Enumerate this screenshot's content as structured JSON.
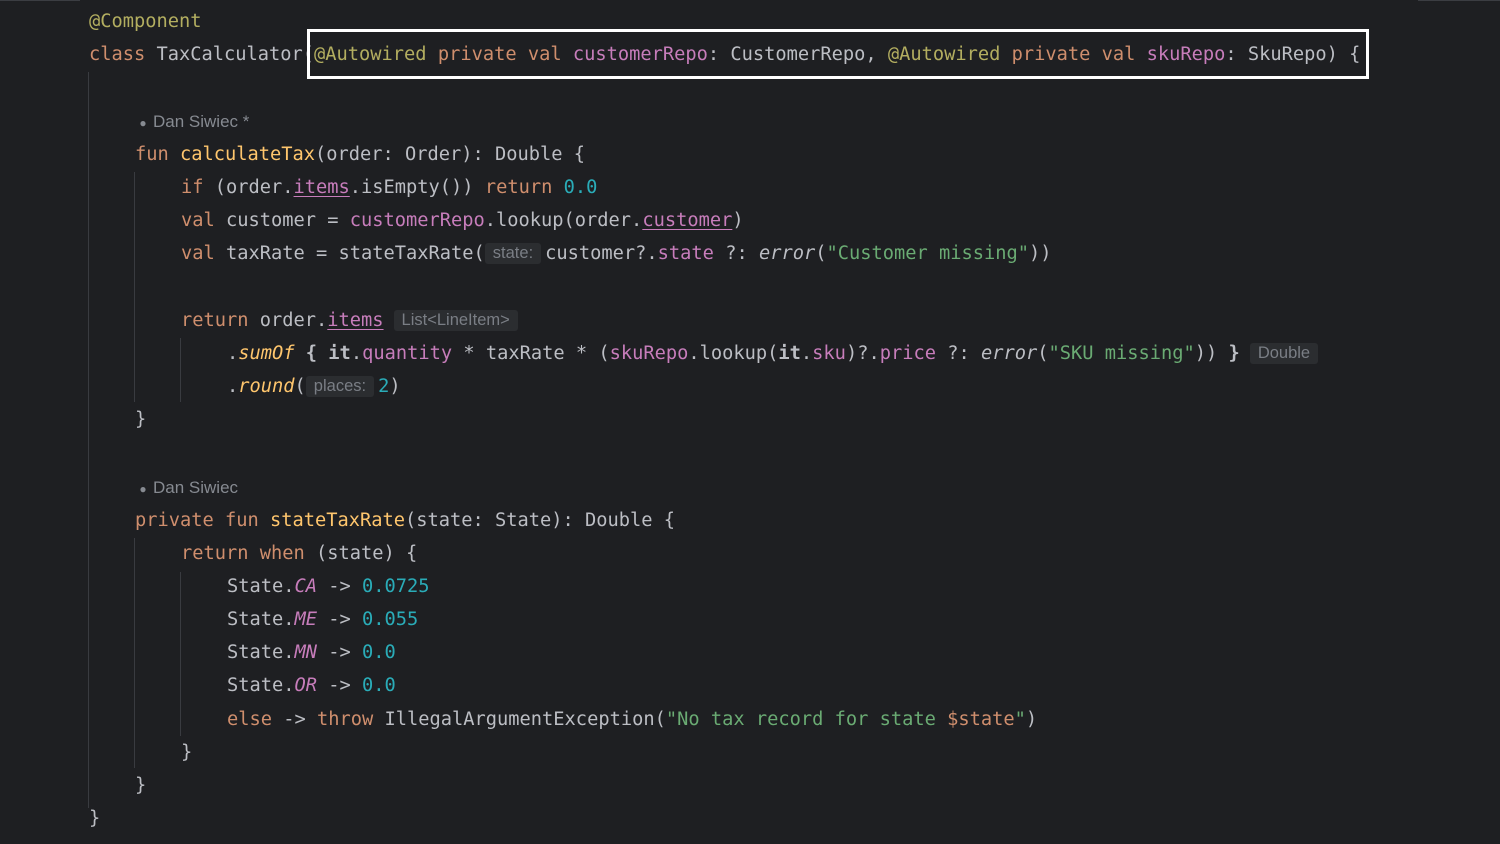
{
  "editor": {
    "annotation_line": "@Component",
    "class_line": {
      "kw_class": "class",
      "class_name": " TaxCalculator",
      "open_paren": "(",
      "autowired1": "@Autowired",
      "private1": " private val ",
      "param1_name": "customerRepo",
      "param1_type": ": CustomerRepo, ",
      "autowired2": "@Autowired",
      "private2": " private val ",
      "param2_name": "skuRepo",
      "param2_type": ": SkuRepo",
      "close": ") {"
    },
    "author1": "Dan Siwiec *",
    "author2": "Dan Siwiec",
    "calc_sig": {
      "kw": "fun ",
      "name": "calculateTax",
      "rest": "(order: Order): Double {"
    },
    "if_line": {
      "kw_if": "if",
      "pre": " (order.",
      "items": "items",
      "post": ".isEmpty()) ",
      "kw_return": "return",
      "num": " 0.0"
    },
    "customer_line": {
      "kw_val": "val",
      "pre": " customer = ",
      "repo": "customerRepo",
      "mid": ".lookup(order.",
      "cust": "customer",
      "post": ")"
    },
    "taxrate_line": {
      "kw_val": "val",
      "pre": " taxRate = stateTaxRate(",
      "hint": "state:",
      "cust": "customer?.",
      "state": "state",
      "elvis": " ?: ",
      "error": "error",
      "open": "(",
      "msg": "\"Customer missing\"",
      "close": "))"
    },
    "return_items": {
      "kw": "return",
      "pre": " order.",
      "items": "items",
      "hint": "List<LineItem>"
    },
    "sumof_line": {
      "dot": ".",
      "sumof": "sumOf",
      "brace": " { ",
      "it1": "it",
      "dot2": ".",
      "qty": "quantity",
      "mid": " * taxRate * (",
      "repo": "skuRepo",
      "lookup": ".lookup(",
      "it2": "it",
      "dot3": ".",
      "sku": "sku",
      "after": ")?.",
      "price": "price",
      "elvis": " ?: ",
      "error": "error",
      "open": "(",
      "msg": "\"SKU missing\"",
      "close": ")) ",
      "endbrace": "}",
      "hint": "Double"
    },
    "round_line": {
      "dot": ".",
      "round": "round",
      "open": "(",
      "hint": "places:",
      "num": "2",
      "close": ")"
    },
    "brace_close": "}",
    "state_sig": {
      "kw": "private fun ",
      "name": "stateTaxRate",
      "rest": "(state: State): Double {"
    },
    "when_line": {
      "kw": "return when",
      "rest": " (state) {"
    },
    "cases": [
      {
        "prefix": "State.",
        "state": "CA",
        "arrow": " -> ",
        "value": "0.0725"
      },
      {
        "prefix": "State.",
        "state": "ME",
        "arrow": " -> ",
        "value": "0.055"
      },
      {
        "prefix": "State.",
        "state": "MN",
        "arrow": " -> ",
        "value": "0.0"
      },
      {
        "prefix": "State.",
        "state": "OR",
        "arrow": " -> ",
        "value": "0.0"
      }
    ],
    "else_line": {
      "kw_else": "else",
      "arrow": " -> ",
      "kw_throw": "throw",
      "exc": " IllegalArgumentException(",
      "msg": "\"No tax record for state ",
      "dollar": "$state",
      "msg_end": "\"",
      "close": ")"
    }
  },
  "colors": {
    "background": "#1e1f22",
    "keyword": "#cf8e6d",
    "annotation": "#b3ae60",
    "function": "#56a8f5",
    "property": "#c77dbb",
    "number": "#2aacb8",
    "string": "#6aab73",
    "highlight_box": "#ffffff"
  }
}
